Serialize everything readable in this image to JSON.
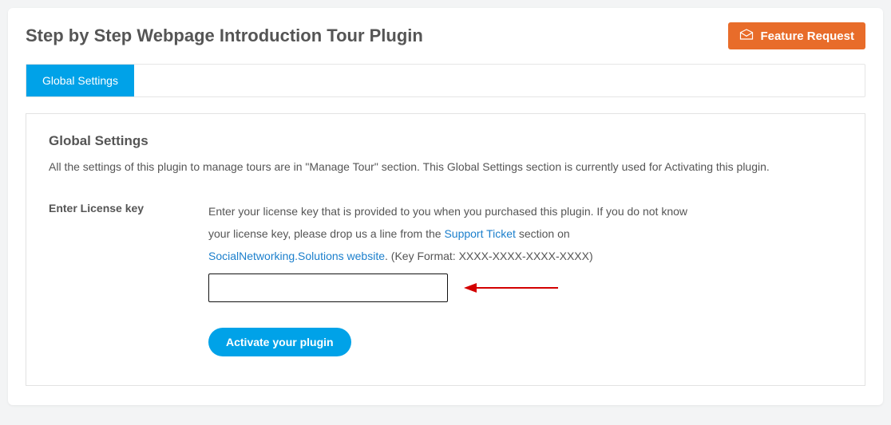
{
  "header": {
    "title": "Step by Step Webpage Introduction Tour Plugin",
    "feature_request_label": "Feature Request"
  },
  "tabs": [
    {
      "label": "Global Settings",
      "active": true
    }
  ],
  "panel": {
    "title": "Global Settings",
    "description": "All the settings of this plugin to manage tours are in \"Manage Tour\" section. This Global Settings section is currently used for Activating this plugin."
  },
  "form": {
    "label": "Enter License key",
    "help_prefix": "Enter your license key that is provided to you when you purchased this plugin. If you do not know your license key, please drop us a line from the ",
    "support_ticket_link": "Support Ticket",
    "help_mid": " section on ",
    "site_link": "SocialNetworking.Solutions website",
    "help_suffix": ". (Key Format: XXXX-XXXX-XXXX-XXXX)",
    "input_value": "",
    "activate_label": "Activate your plugin"
  }
}
